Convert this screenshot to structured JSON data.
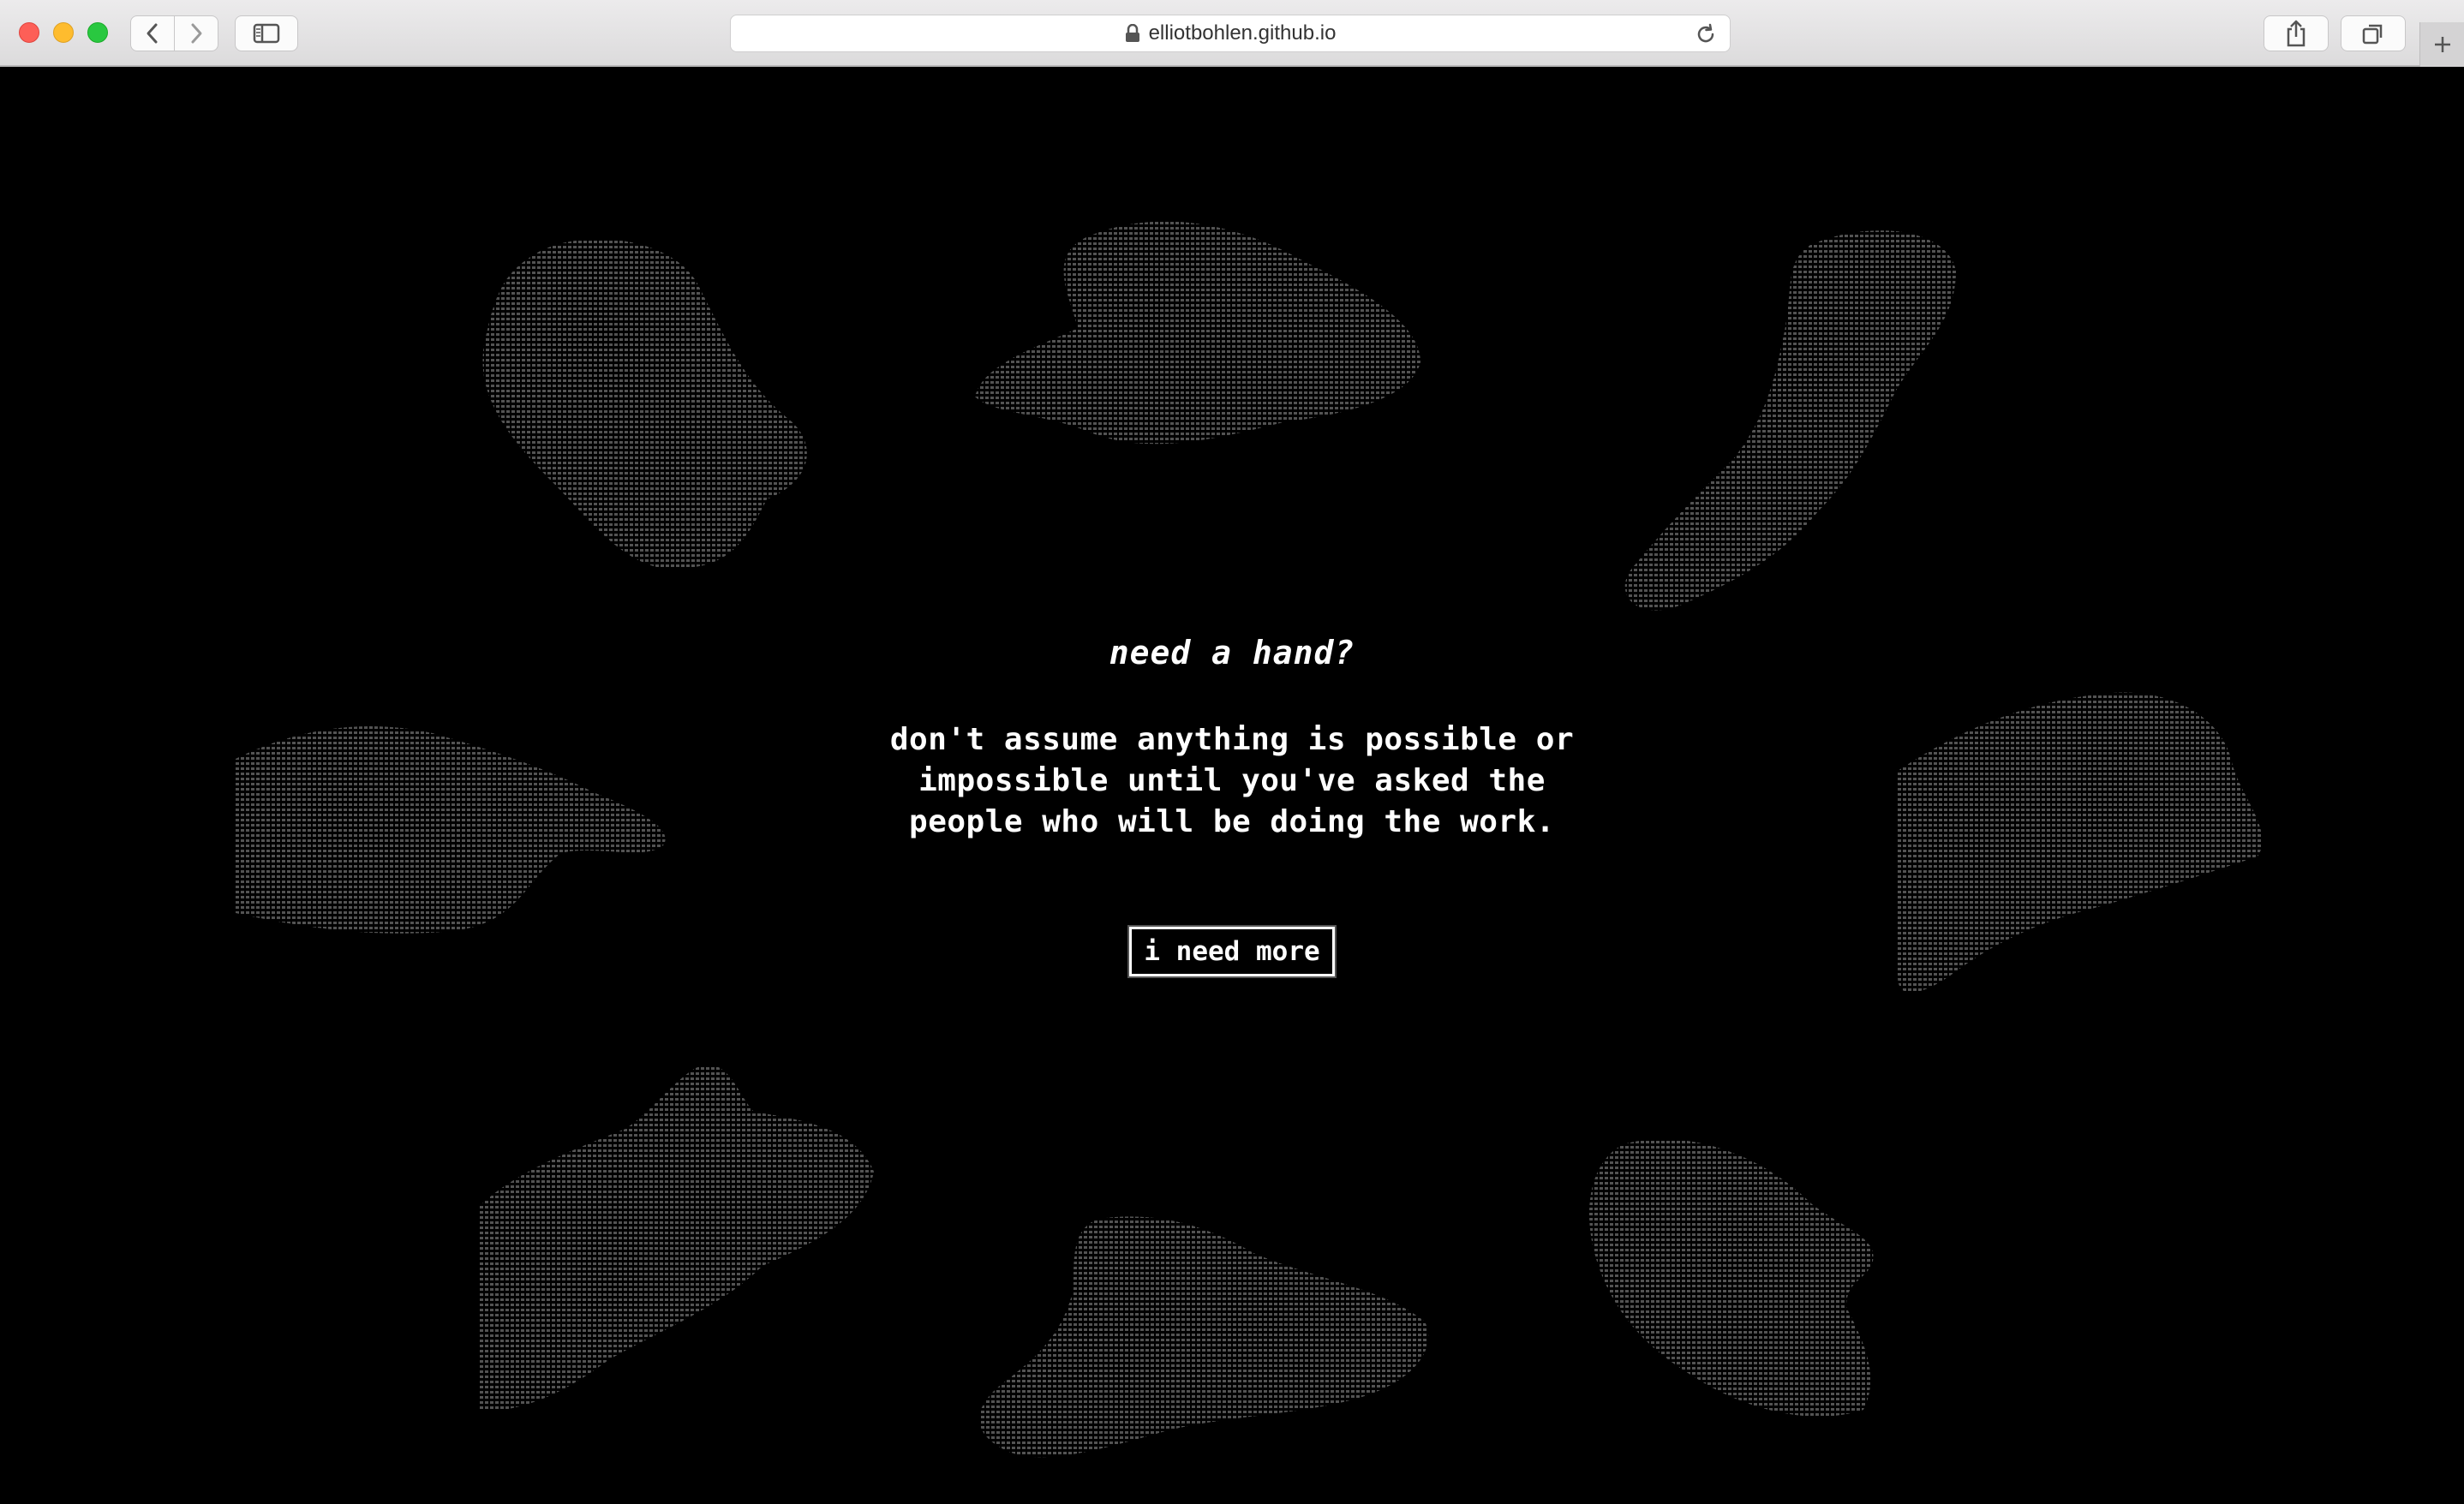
{
  "browser": {
    "url": "elliotbohlen.github.io",
    "icons": {
      "back": "chevron-left-icon",
      "forward": "chevron-right-icon",
      "sidebar": "sidebar-icon",
      "lock": "lock-icon",
      "reload": "reload-icon",
      "share": "share-icon",
      "tabs": "tabs-icon",
      "new_tab": "plus-icon"
    }
  },
  "page": {
    "headline": "need a hand?",
    "quote": "don't assume anything is possible or impossible until you've asked the people who will be doing the work.",
    "button_label": "i need more",
    "background_color": "#000000",
    "text_color": "#ffffff"
  }
}
